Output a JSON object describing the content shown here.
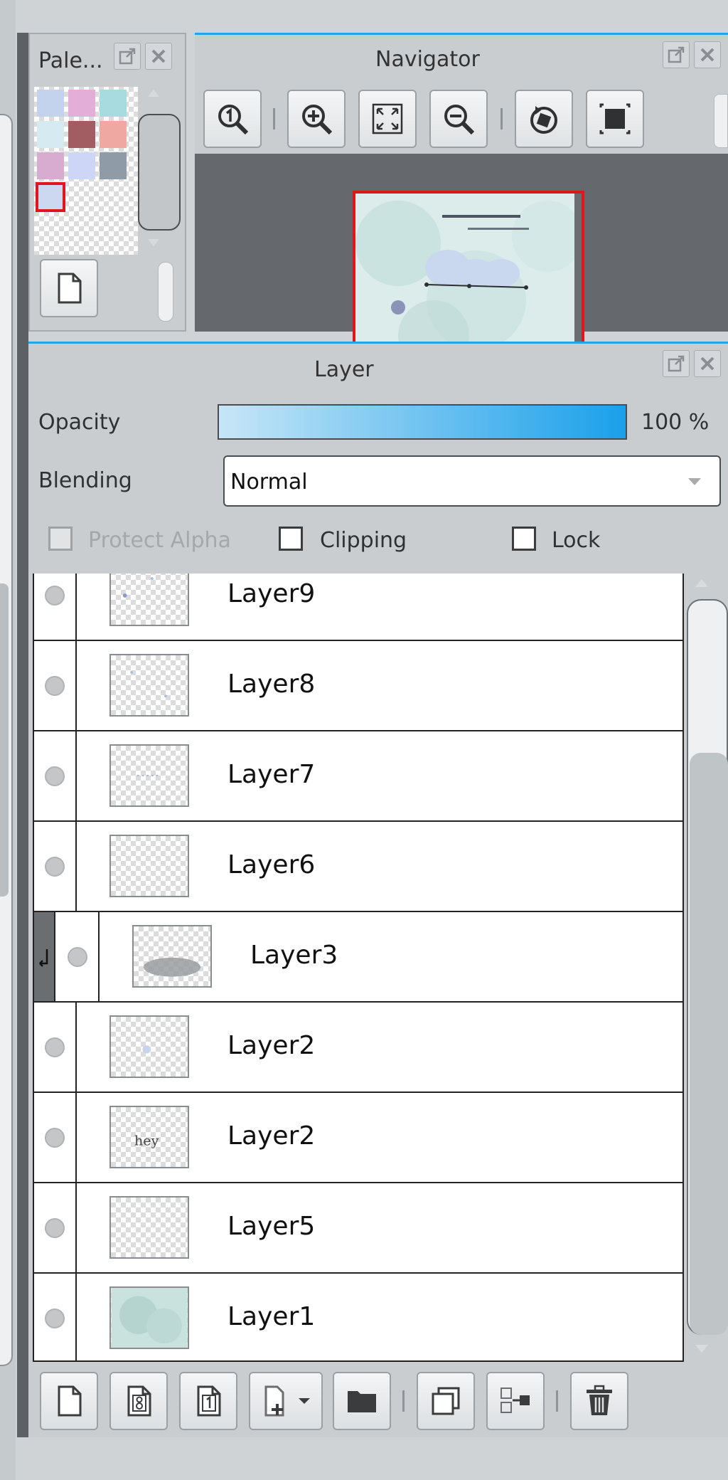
{
  "palette": {
    "title": "Pale...",
    "swatches": [
      "#c3d3ee",
      "#e3aed8",
      "#a7dbe0",
      "#d6eaf2",
      "#a15d62",
      "#f0a9a2",
      "#d7acd0",
      "#cdd6f6",
      "#8f9ca8"
    ],
    "selected_swatch": "#cbd8ef",
    "new_button": "new-palette"
  },
  "navigator": {
    "title": "Navigator",
    "tools": [
      "actual-size",
      "zoom-in",
      "fit",
      "zoom-out",
      "rotate-reset",
      "flip"
    ]
  },
  "layer_panel": {
    "title": "Layer",
    "opacity_label": "Opacity",
    "opacity_value": "100 %",
    "opacity_fraction": 1.0,
    "blending_label": "Blending",
    "blending_value": "Normal",
    "protect_alpha_label": "Protect Alpha",
    "clipping_label": "Clipping",
    "lock_label": "Lock",
    "layers": [
      {
        "name": "Layer9",
        "clipped": false
      },
      {
        "name": "Layer8",
        "clipped": false
      },
      {
        "name": "Layer7",
        "clipped": false
      },
      {
        "name": "Layer6",
        "clipped": false
      },
      {
        "name": "Layer3",
        "clipped": true
      },
      {
        "name": "Layer2",
        "clipped": false
      },
      {
        "name": "Layer2",
        "clipped": false
      },
      {
        "name": "Layer5",
        "clipped": false
      },
      {
        "name": "Layer1",
        "clipped": false
      }
    ]
  },
  "colors": {
    "accent": "#27a4e3",
    "selection": "#e0161f"
  }
}
